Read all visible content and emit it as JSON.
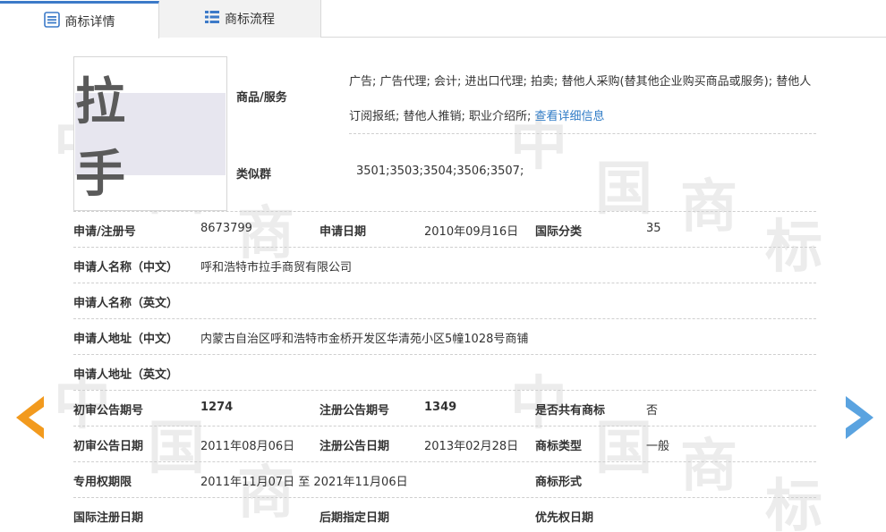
{
  "tabs": [
    {
      "label": "商标详情",
      "icon": "detail-list-icon",
      "active": true
    },
    {
      "label": "商标流程",
      "icon": "flow-list-icon",
      "active": false
    }
  ],
  "watermark": [
    "中",
    "国",
    "商",
    "标"
  ],
  "logo": {
    "text": "拉 手"
  },
  "goods": {
    "label": "商品/服务",
    "text": "广告; 广告代理; 会计; 进出口代理; 拍卖; 替他人采购(替其他企业购买商品或服务); 替他人订阅报纸; 替他人推销; 职业介绍所;",
    "link": "查看详细信息"
  },
  "similar_group": {
    "label": "类似群",
    "value": "3501;3503;3504;3506;3507;"
  },
  "rows": {
    "reg_no": {
      "label": "申请/注册号",
      "value": "8673799"
    },
    "apply_date": {
      "label": "申请日期",
      "value": "2010年09月16日"
    },
    "intl_class": {
      "label": "国际分类",
      "value": "35"
    },
    "applicant_cn": {
      "label": "申请人名称（中文）",
      "value": "呼和浩特市拉手商贸有限公司"
    },
    "applicant_en": {
      "label": "申请人名称（英文）",
      "value": ""
    },
    "address_cn": {
      "label": "申请人地址（中文）",
      "value": "内蒙古自治区呼和浩特市金桥开发区华清苑小区5幢1028号商铺"
    },
    "address_en": {
      "label": "申请人地址（英文）",
      "value": ""
    },
    "prelim_no": {
      "label": "初审公告期号",
      "value": "1274"
    },
    "reg_notice_no": {
      "label": "注册公告期号",
      "value": "1349"
    },
    "shared": {
      "label": "是否共有商标",
      "value": "否"
    },
    "prelim_date": {
      "label": "初审公告日期",
      "value": "2011年08月06日"
    },
    "reg_notice_date": {
      "label": "注册公告日期",
      "value": "2013年02月28日"
    },
    "tm_type": {
      "label": "商标类型",
      "value": "一般"
    },
    "exclusive_period": {
      "label": "专用权期限",
      "value": "2011年11月07日 至 2021年11月06日"
    },
    "tm_form": {
      "label": "商标形式",
      "value": ""
    },
    "intl_reg_date": {
      "label": "国际注册日期",
      "value": ""
    },
    "later_date": {
      "label": "后期指定日期",
      "value": ""
    },
    "priority_date": {
      "label": "优先权日期",
      "value": ""
    }
  },
  "nav": {
    "prev": "prev-arrow-icon",
    "next": "next-arrow-icon"
  },
  "colors": {
    "accent": "#3c7ac8",
    "link": "#2f7bc6",
    "prev_arrow": "#f29a1e",
    "next_arrow": "#5aa3e0"
  }
}
